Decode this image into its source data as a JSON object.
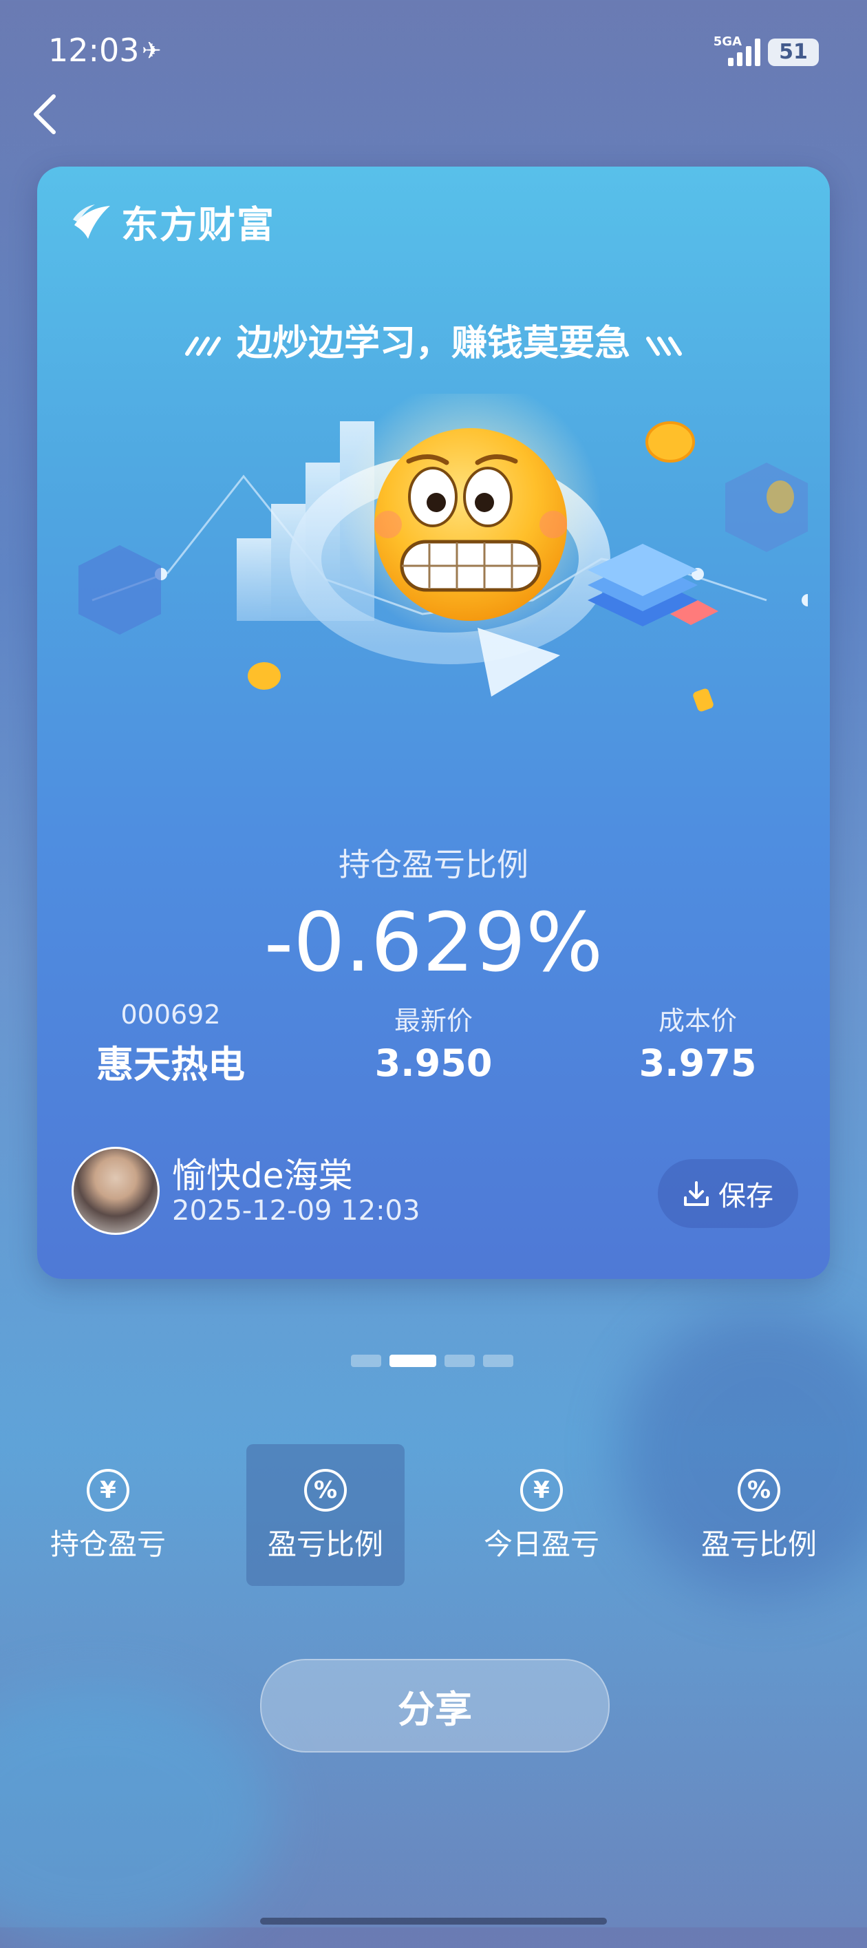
{
  "status_bar": {
    "time": "12:03",
    "network": "5GA",
    "battery": "51"
  },
  "card": {
    "brand": "东方财富",
    "slogan": "边炒边学习，赚钱莫要急",
    "metric_label": "持仓盈亏比例",
    "metric_value": "-0.629%",
    "stock_code": "000692",
    "stock_name": "惠天热电",
    "latest_price_label": "最新价",
    "latest_price": "3.950",
    "cost_price_label": "成本价",
    "cost_price": "3.975",
    "username": "愉快de海棠",
    "datetime": "2025-12-09 12:03",
    "save_label": "保存"
  },
  "pager": {
    "count": 4,
    "active_index": 1
  },
  "tabs": [
    {
      "label": "持仓盈亏",
      "icon": "yen-circle-icon",
      "glyph": "¥",
      "active": false
    },
    {
      "label": "盈亏比例",
      "icon": "percent-circle-icon",
      "glyph": "%",
      "active": true
    },
    {
      "label": "今日盈亏",
      "icon": "yen-circle-icon",
      "glyph": "¥",
      "active": false
    },
    {
      "label": "盈亏比例",
      "icon": "percent-circle-icon",
      "glyph": "%",
      "active": false
    }
  ],
  "share_label": "分享"
}
